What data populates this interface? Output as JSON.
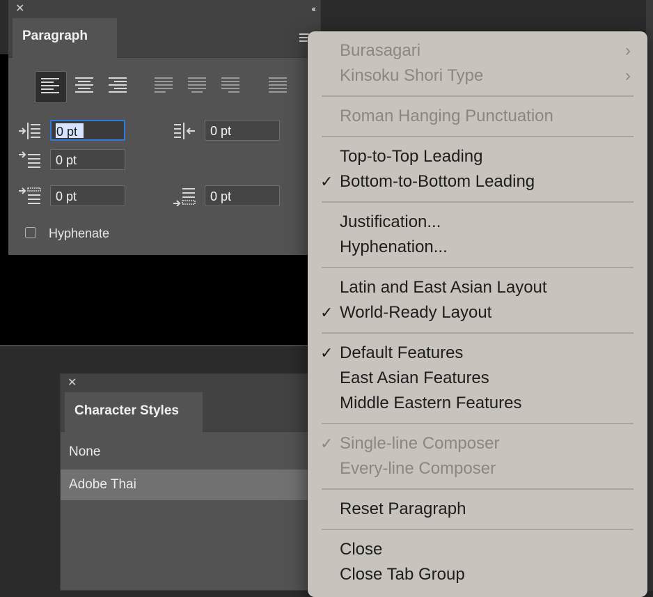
{
  "paragraph_panel": {
    "tab_label": "Paragraph",
    "alignment_buttons": [
      "align-left",
      "align-center",
      "align-right",
      "justify-last-left",
      "justify-last-center",
      "justify-last-right",
      "justify-all"
    ],
    "active_alignment": "align-left",
    "fields": {
      "left_indent": "0 pt",
      "right_indent": "0 pt",
      "first_line_indent": "0 pt",
      "space_before": "0 pt",
      "space_after": "0 pt"
    },
    "hyphenate_label": "Hyphenate",
    "hyphenate_checked": false
  },
  "character_styles_panel": {
    "tab_label": "Character Styles",
    "rows": [
      "None",
      "Adobe Thai"
    ],
    "selected_row": "Adobe Thai"
  },
  "menu": {
    "groups": [
      {
        "items": [
          {
            "label": "Burasagari",
            "disabled": true,
            "submenu": true
          },
          {
            "label": "Kinsoku Shori Type",
            "disabled": true,
            "submenu": true
          }
        ]
      },
      {
        "items": [
          {
            "label": "Roman Hanging Punctuation",
            "disabled": true
          }
        ]
      },
      {
        "items": [
          {
            "label": "Top-to-Top Leading",
            "disabled": false,
            "checked": false
          },
          {
            "label": "Bottom-to-Bottom Leading",
            "disabled": false,
            "checked": true
          }
        ]
      },
      {
        "items": [
          {
            "label": "Justification...",
            "disabled": false
          },
          {
            "label": "Hyphenation...",
            "disabled": false
          }
        ]
      },
      {
        "items": [
          {
            "label": "Latin and East Asian Layout",
            "disabled": false,
            "checked": false
          },
          {
            "label": "World-Ready Layout",
            "disabled": false,
            "checked": true
          }
        ]
      },
      {
        "items": [
          {
            "label": "Default Features",
            "disabled": false,
            "checked": true
          },
          {
            "label": "East Asian Features",
            "disabled": false
          },
          {
            "label": "Middle Eastern Features",
            "disabled": false
          }
        ]
      },
      {
        "items": [
          {
            "label": "Single-line Composer",
            "disabled": true,
            "checked": true
          },
          {
            "label": "Every-line Composer",
            "disabled": true
          }
        ]
      },
      {
        "items": [
          {
            "label": "Reset Paragraph",
            "disabled": false
          }
        ]
      },
      {
        "items": [
          {
            "label": "Close",
            "disabled": false
          },
          {
            "label": "Close Tab Group",
            "disabled": false
          }
        ]
      }
    ],
    "check_glyph": "✓",
    "submenu_glyph": "›"
  },
  "glyphs": {
    "close": "✕",
    "collapse": "‹‹"
  },
  "colors": {
    "panel_bg": "#535353",
    "menu_bg": "#c8c4bd",
    "focus_blue": "#2f7be0"
  }
}
